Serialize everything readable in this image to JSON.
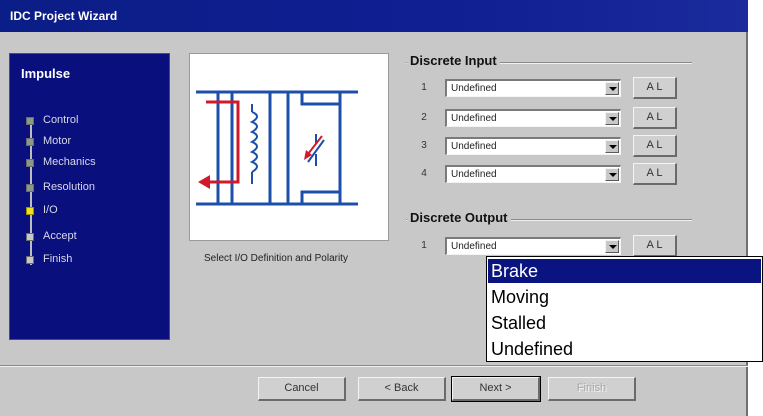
{
  "window": {
    "title": "IDC Project Wizard"
  },
  "steps": {
    "title": "Impulse",
    "items": [
      {
        "label": "Control",
        "state": "done"
      },
      {
        "label": "Motor",
        "state": "done"
      },
      {
        "label": "Mechanics",
        "state": "done"
      },
      {
        "label": "Resolution",
        "state": "done"
      },
      {
        "label": "I/O",
        "state": "current"
      },
      {
        "label": "Accept",
        "state": "future"
      },
      {
        "label": "Finish",
        "state": "future"
      }
    ]
  },
  "image": {
    "caption": "Select I/O Definition and Polarity",
    "icon": "relay-diagram-icon"
  },
  "discrete_input": {
    "title": "Discrete Input",
    "rows": [
      {
        "num": "1",
        "value": "Undefined",
        "button": "A L"
      },
      {
        "num": "2",
        "value": "Undefined",
        "button": "A L"
      },
      {
        "num": "3",
        "value": "Undefined",
        "button": "A L"
      },
      {
        "num": "4",
        "value": "Undefined",
        "button": "A L"
      }
    ]
  },
  "discrete_output": {
    "title": "Discrete Output",
    "rows": [
      {
        "num": "1",
        "value": "Undefined",
        "button": "A L"
      }
    ]
  },
  "dropdown": {
    "options": [
      "Brake",
      "Moving",
      "Stalled",
      "Undefined"
    ],
    "selected": "Brake"
  },
  "buttons": {
    "cancel": "Cancel",
    "back": "< Back",
    "next": "Next >",
    "finish": "Finish"
  },
  "colors": {
    "title_bar": "#0b1d86",
    "steps_panel": "#0a0f7e",
    "dialog_bg": "#c8c8c8",
    "diagram_blue": "#1c4fa8",
    "diagram_red": "#d01a2c",
    "current_step": "#f0e020"
  }
}
